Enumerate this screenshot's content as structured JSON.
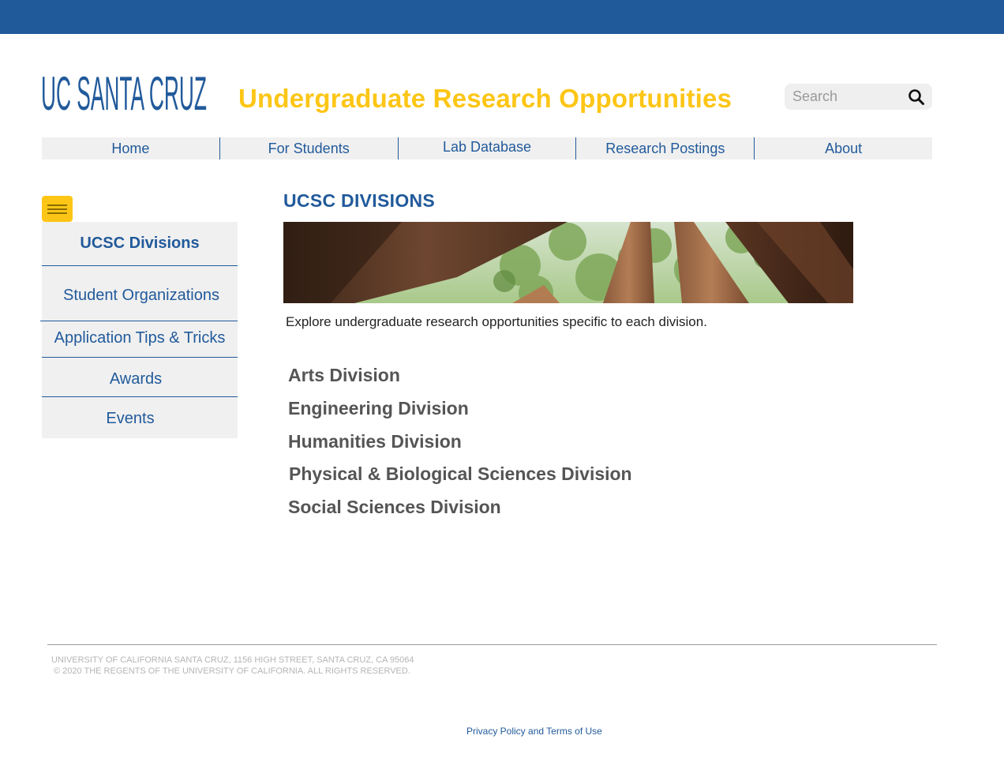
{
  "header": {
    "logo_text": "UC SANTA CRUZ",
    "site_title": "Undergraduate Research Opportunities",
    "search_placeholder": "Search"
  },
  "nav": {
    "items": [
      "Home",
      "For Students",
      "Lab Database",
      "Research Postings",
      "About"
    ]
  },
  "sidebar": {
    "items": [
      "UCSC Divisions",
      "Student Organizations",
      "Application Tips & Tricks",
      "Awards",
      "Events"
    ]
  },
  "main": {
    "heading": "UCSC DIVISIONS",
    "intro": "Explore undergraduate research opportunities specific to each division.",
    "divisions": [
      "Arts Division",
      "Engineering Division",
      "Humanities Division",
      "Physical & Biological Sciences Division",
      "Social Sciences Division"
    ]
  },
  "footer": {
    "address": "UNIVERSITY OF CALIFORNIA SANTA CRUZ, 1156 HIGH STREET, SANTA CRUZ, CA 95064",
    "copyright": "© 2020 THE REGENTS OF THE UNIVERSITY OF CALIFORNIA. ALL RIGHTS RESERVED.",
    "privacy": "Privacy Policy and Terms of Use"
  },
  "colors": {
    "brand_blue": "#215a9b",
    "brand_gold": "#fdc616",
    "division_gray": "#555555"
  }
}
